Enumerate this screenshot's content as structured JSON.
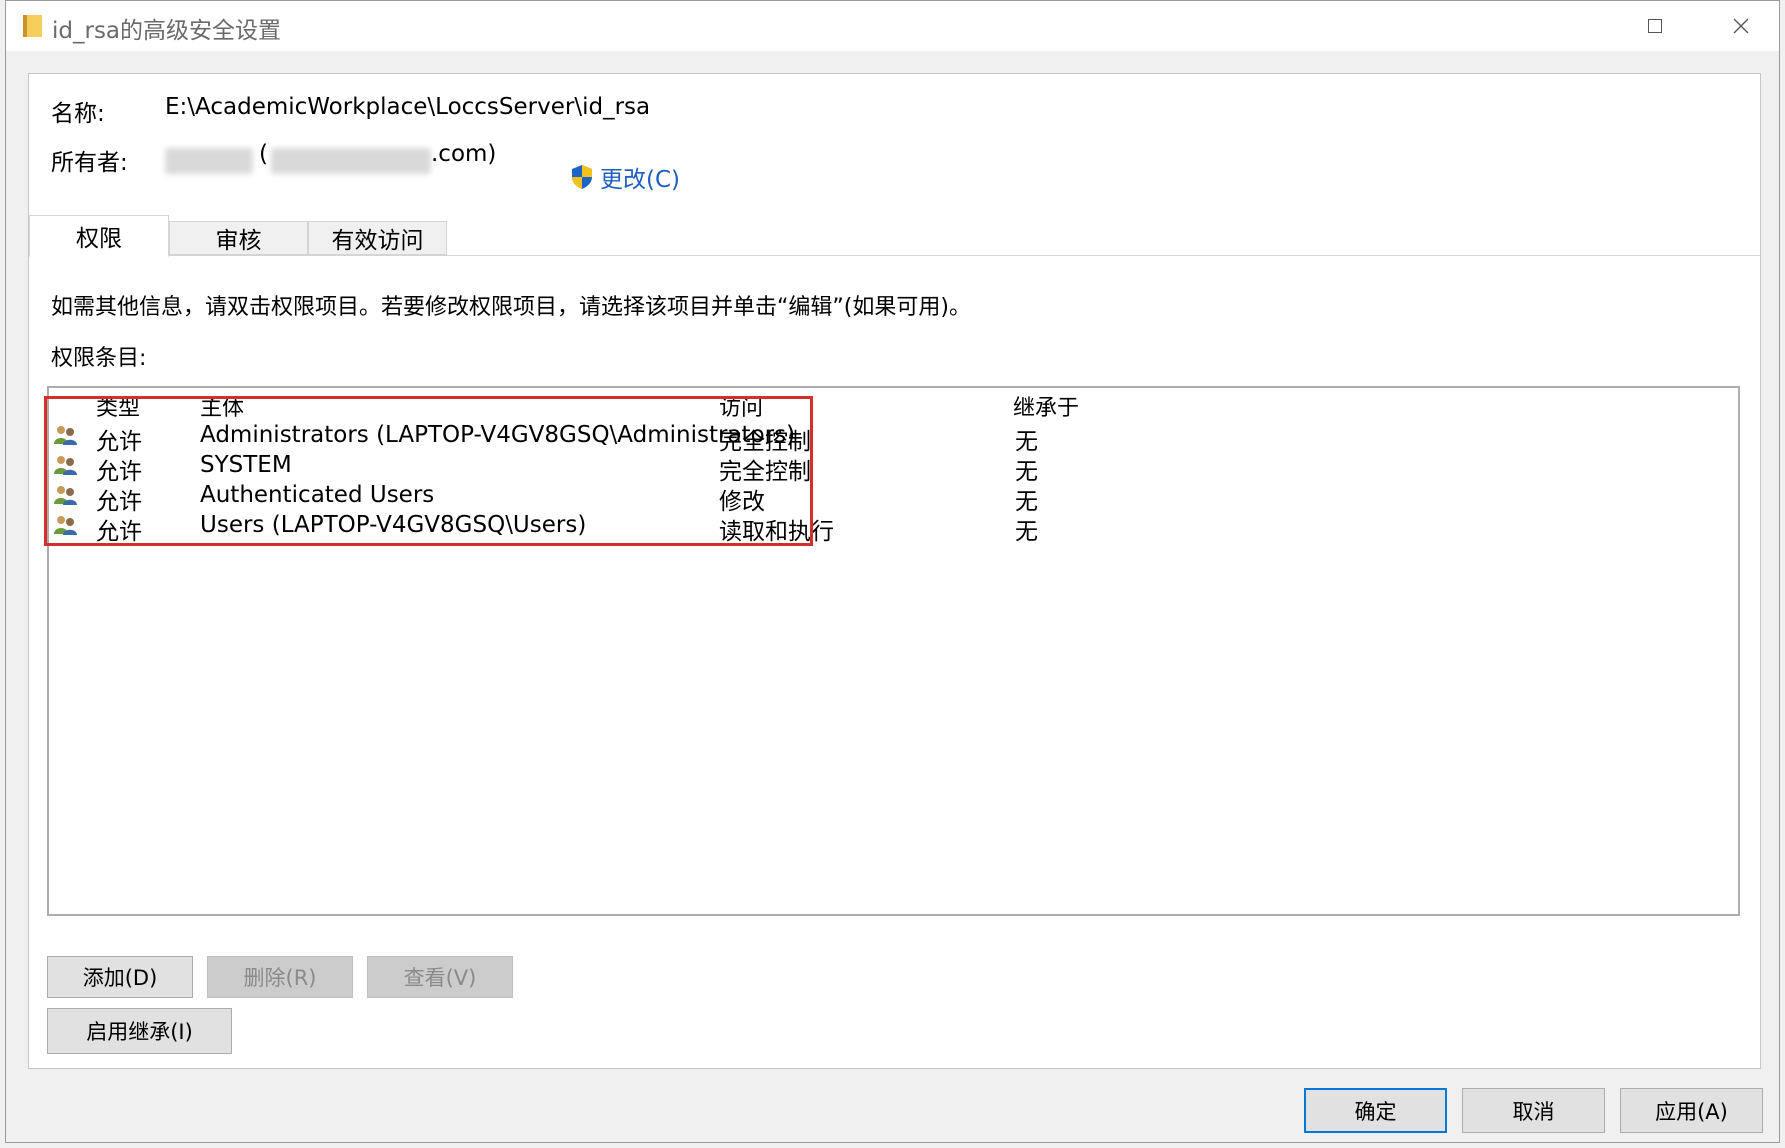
{
  "window": {
    "title": "id_rsa的高级安全设置",
    "controls": [
      "minimize",
      "maximize",
      "close"
    ]
  },
  "header": {
    "name_label": "名称:",
    "name_value": "E:\\AcademicWorkplace\\LoccsServer\\id_rsa",
    "owner_label": "所有者:",
    "owner_prefix": "(",
    "owner_suffix": ".com)",
    "change_label": "更改(C)"
  },
  "tabs": [
    {
      "label": "权限",
      "active": true
    },
    {
      "label": "审核",
      "active": false
    },
    {
      "label": "有效访问",
      "active": false
    }
  ],
  "info_text": "如需其他信息，请双击权限项目。若要修改权限项目，请选择该项目并单击“编辑”(如果可用)。",
  "entries_label": "权限条目:",
  "table": {
    "columns": [
      "类型",
      "主体",
      "访问",
      "继承于"
    ],
    "rows": [
      {
        "type": "允许",
        "principal": "Administrators (LAPTOP-V4GV8GSQ\\Administrators)",
        "access": "完全控制",
        "inherited": "无"
      },
      {
        "type": "允许",
        "principal": "SYSTEM",
        "access": "完全控制",
        "inherited": "无"
      },
      {
        "type": "允许",
        "principal": "Authenticated Users",
        "access": "修改",
        "inherited": "无"
      },
      {
        "type": "允许",
        "principal": "Users (LAPTOP-V4GV8GSQ\\Users)",
        "access": "读取和执行",
        "inherited": "无"
      }
    ]
  },
  "buttons": {
    "add": "添加(D)",
    "remove": "删除(R)",
    "view": "查看(V)",
    "enable_inheritance": "启用继承(I)",
    "ok": "确定",
    "cancel": "取消",
    "apply": "应用(A)"
  },
  "colors": {
    "link": "#1f5fbf",
    "highlight": "#d32f2f",
    "focus": "#0078d7"
  }
}
